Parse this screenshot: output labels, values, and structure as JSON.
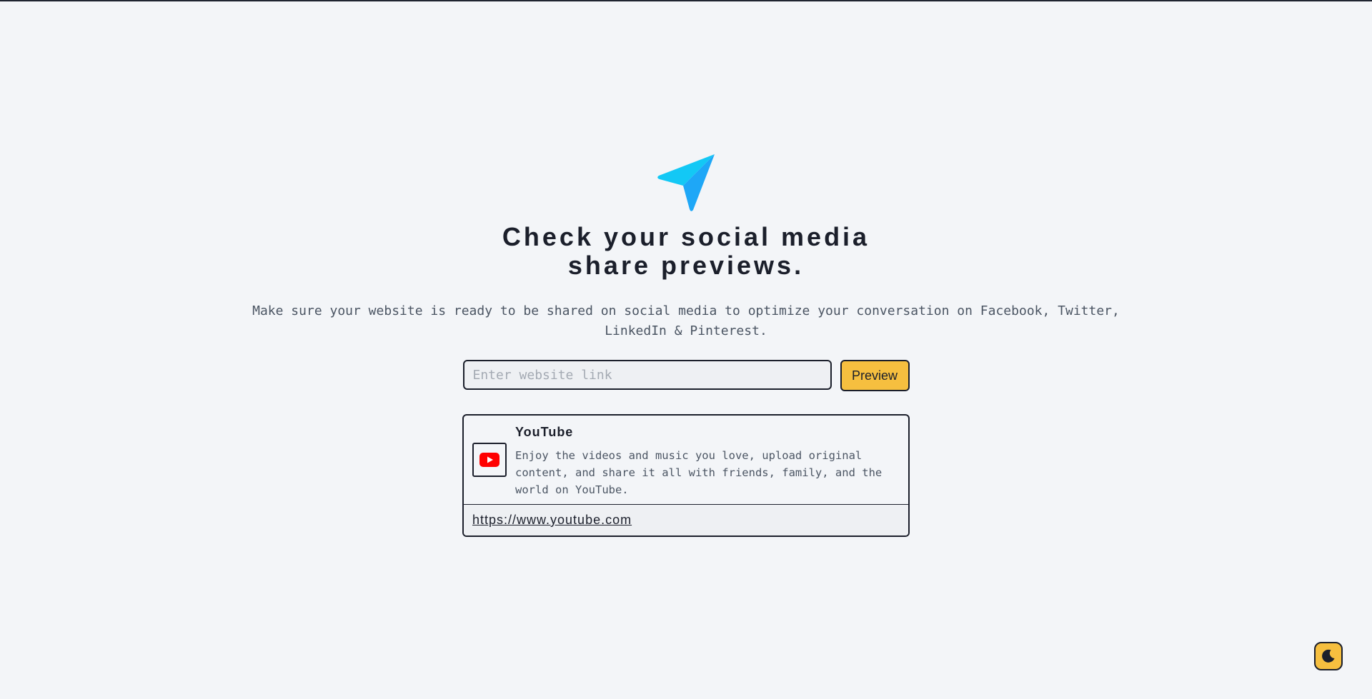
{
  "hero": {
    "logo_icon": "paper-plane-icon",
    "title_line1": "Check your social media",
    "title_line2": "share previews.",
    "subtitle": "Make sure your website is ready to be shared on social media to optimize your conversation on Facebook, Twitter, LinkedIn & Pinterest."
  },
  "form": {
    "input_value": "",
    "input_placeholder": "Enter website link",
    "preview_label": "Preview"
  },
  "preview_card": {
    "favicon_icon": "youtube-icon",
    "title": "YouTube",
    "description": "Enjoy the videos and music you love, upload original content, and share it all with friends, family, and the world on YouTube.",
    "url": "https://www.youtube.com"
  },
  "theme_toggle": {
    "icon": "moon-icon"
  },
  "colors": {
    "background": "#f3f5f8",
    "accent": "#f6bf3f",
    "text": "#1b1f2b",
    "muted_text": "#4b5563",
    "logo_light": "#13c8f5",
    "logo_dark": "#1ea7f7",
    "youtube_red": "#ff0000"
  }
}
